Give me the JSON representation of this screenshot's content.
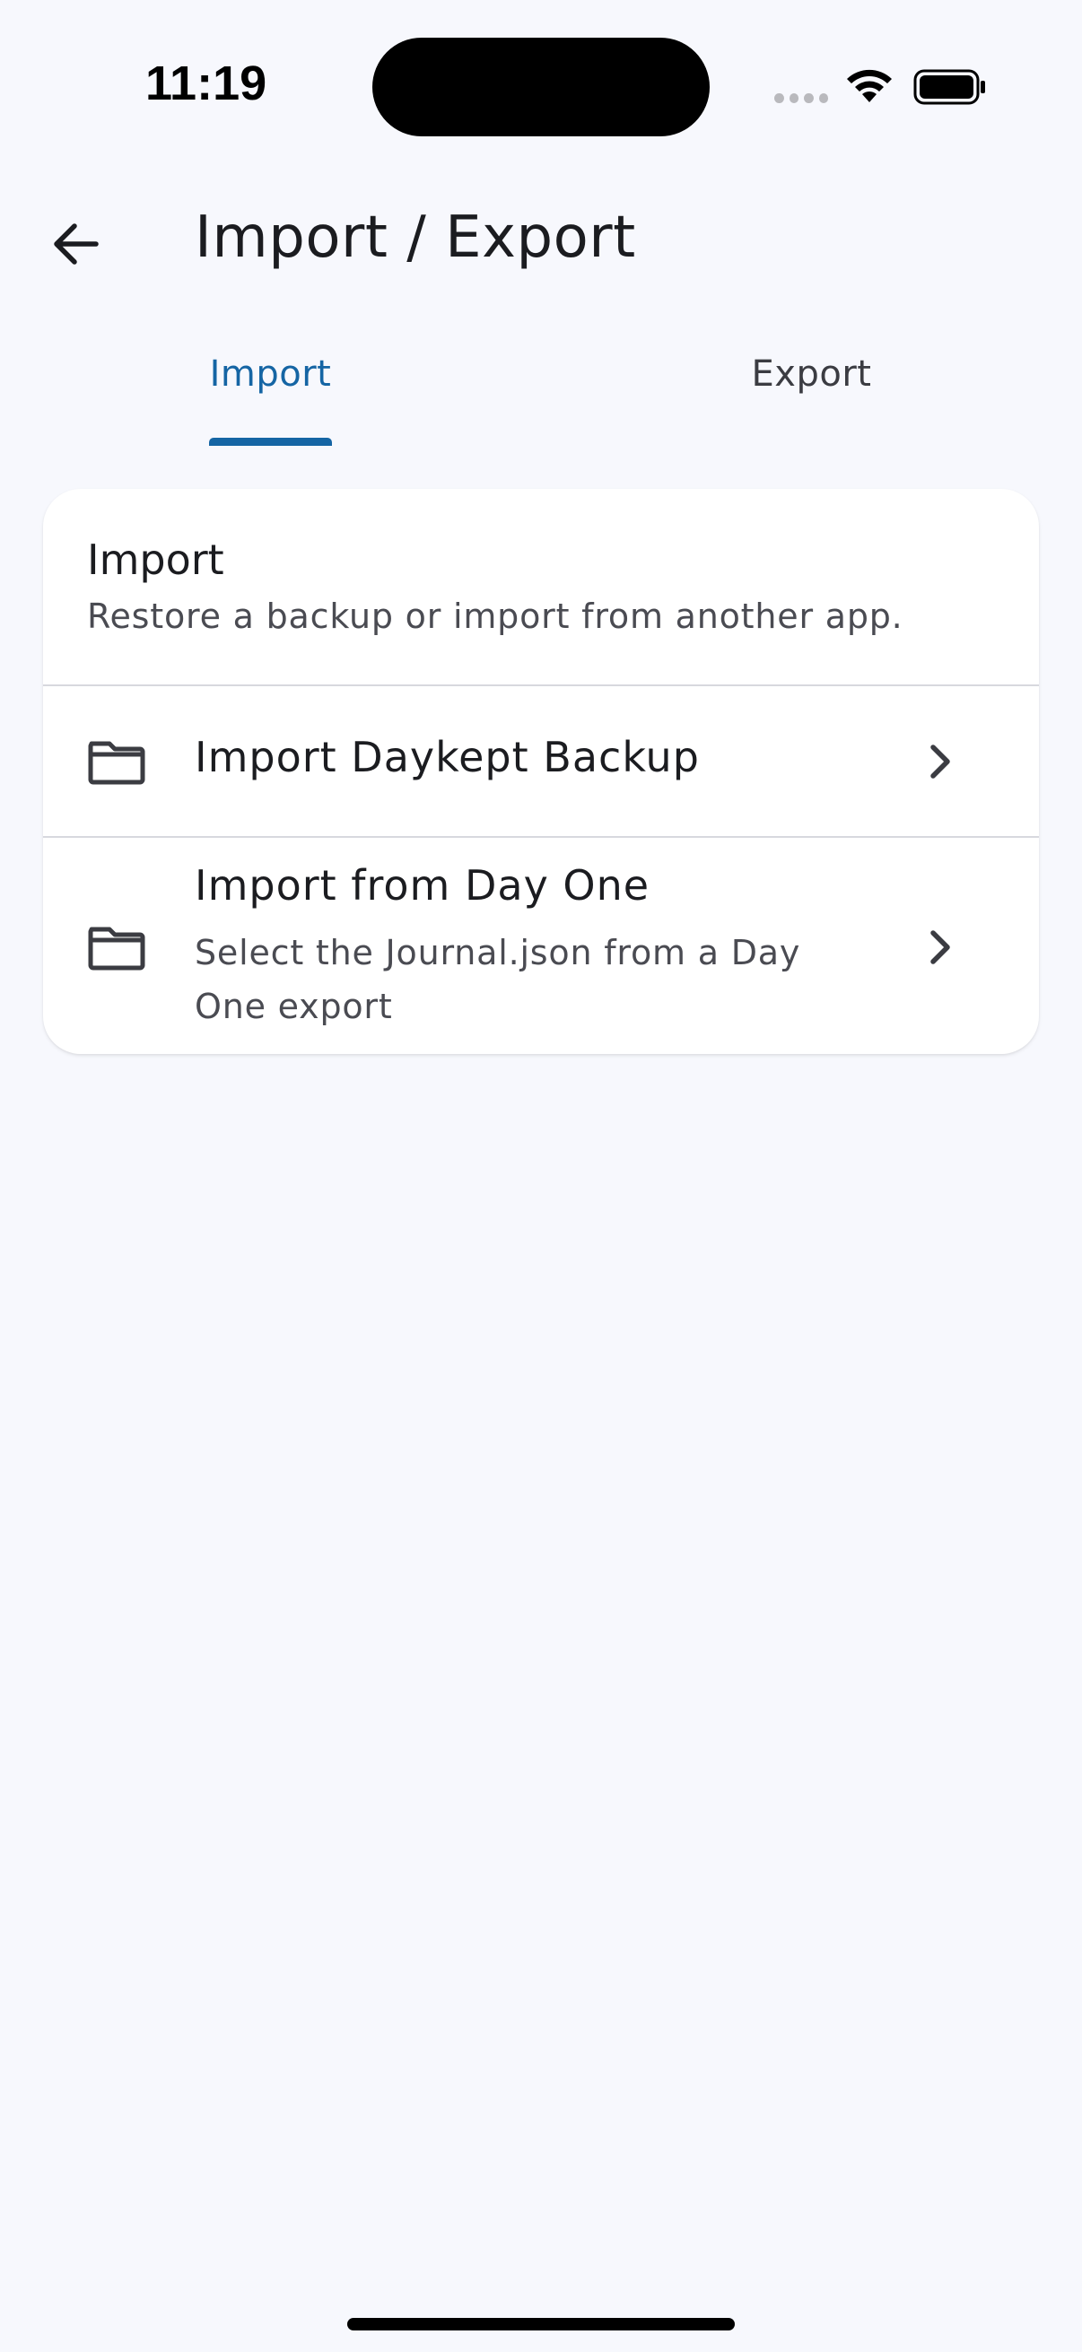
{
  "status_bar": {
    "time": "11:19",
    "icons": [
      "signal-dots-icon",
      "wifi-icon",
      "battery-icon"
    ]
  },
  "app_bar": {
    "title": "Import / Export",
    "back_icon": "arrow-back-icon"
  },
  "tabs": [
    {
      "label": "Import",
      "selected": true
    },
    {
      "label": "Export",
      "selected": false
    }
  ],
  "import_card": {
    "title": "Import",
    "subtitle": "Restore a backup or import from another app.",
    "items": [
      {
        "title": "Import Daykept Backup",
        "subtitle": "",
        "icon": "folder-icon",
        "trailing_icon": "chevron-right-icon"
      },
      {
        "title": "Import from Day One",
        "subtitle": "Select the Journal.json from a Day One export",
        "icon": "folder-icon",
        "trailing_icon": "chevron-right-icon"
      }
    ]
  },
  "colors": {
    "background": "#f7f8fd",
    "card": "#ffffff",
    "accent": "#1565a4",
    "text_primary": "#1b1c20",
    "text_secondary": "#4a4b52",
    "divider": "#d7d8de"
  }
}
